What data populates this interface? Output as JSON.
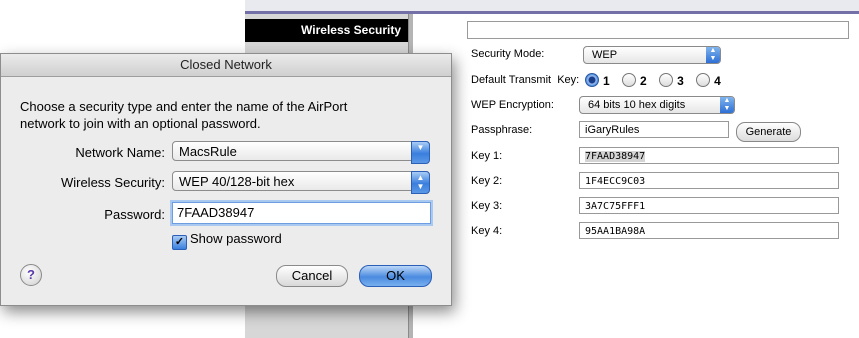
{
  "background_page": {
    "sidebar_header": "Wireless Security",
    "security_mode": {
      "label": "Security Mode:",
      "value": "WEP"
    },
    "default_transmit_key": {
      "label": "Default Transmit  Key:",
      "options": [
        "1",
        "2",
        "3",
        "4"
      ],
      "selected": "1"
    },
    "wep_encryption": {
      "label": "WEP Encryption:",
      "value": "64 bits 10 hex digits"
    },
    "passphrase": {
      "label": "Passphrase:",
      "value": "iGaryRules",
      "generate_label": "Generate"
    },
    "keys": [
      {
        "label": "Key 1:",
        "value": "7FAAD38947"
      },
      {
        "label": "Key 2:",
        "value": "1F4ECC9C03"
      },
      {
        "label": "Key 3:",
        "value": "3A7C75FFF1"
      },
      {
        "label": "Key 4:",
        "value": "95AA1BA98A"
      }
    ]
  },
  "dialog": {
    "title": "Closed Network",
    "description_line1": "Choose a security type and enter the name of the AirPort",
    "description_line2": "network to join with an optional password.",
    "network_name": {
      "label": "Network Name:",
      "value": "MacsRule"
    },
    "wireless_security": {
      "label": "Wireless Security:",
      "value": "WEP 40/128-bit hex"
    },
    "password": {
      "label": "Password:",
      "value": "7FAAD38947"
    },
    "show_password": {
      "label": "Show password",
      "checked": true
    },
    "help_label": "?",
    "cancel_label": "Cancel",
    "ok_label": "OK"
  },
  "colors": {
    "accent_blue": "#3a7fde",
    "sidebar_header_bg": "#000000",
    "dialog_bg": "#ececec"
  }
}
